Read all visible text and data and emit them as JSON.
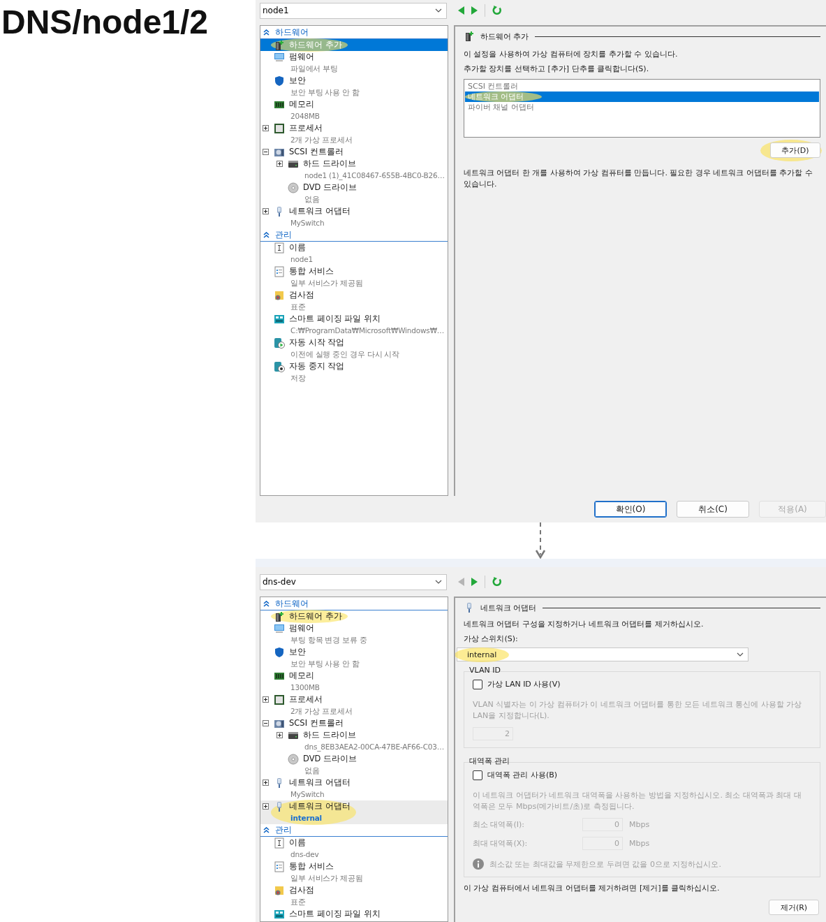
{
  "page_title": "DNS/node1/2",
  "windows": [
    {
      "vm_selector": "node1",
      "back_enabled": true,
      "tree_focused": true,
      "tree": [
        {
          "kind": "section",
          "label": "하드웨어",
          "expanded": true,
          "children": [
            {
              "kind": "add-hardware",
              "label": "하드웨어 추가",
              "selected": true,
              "highlighted": true
            },
            {
              "kind": "firmware",
              "label": "펌웨어",
              "detail": "파일에서 부팅",
              "selected": false,
              "highlighted": false
            },
            {
              "kind": "security",
              "label": "보안",
              "detail": "보안 부팅 사용 안 함",
              "selected": false,
              "highlighted": false
            },
            {
              "kind": "memory",
              "label": "메모리",
              "detail": "2048MB",
              "selected": false,
              "highlighted": false
            },
            {
              "kind": "processor",
              "label": "프로세서",
              "detail": "2개 가상 프로세서",
              "expanded": false,
              "selected": false,
              "highlighted": false
            },
            {
              "kind": "scsi",
              "label": "SCSI 컨트롤러",
              "expanded": true,
              "selected": false,
              "highlighted": false,
              "children": [
                {
                  "kind": "hard-drive",
                  "label": "하드 드라이브",
                  "detail": "node1 (1)_41C08467-655B-4BC0-B26…",
                  "expanded": false,
                  "selected": false,
                  "highlighted": false
                },
                {
                  "kind": "dvd",
                  "label": "DVD 드라이브",
                  "detail": "없음",
                  "selected": false,
                  "highlighted": false
                }
              ]
            },
            {
              "kind": "network",
              "label": "네트워크 어댑터",
              "detail": "MySwitch",
              "expanded": false,
              "selected": false,
              "highlighted": false
            }
          ]
        },
        {
          "kind": "section",
          "label": "관리",
          "expanded": true,
          "children": [
            {
              "kind": "name",
              "label": "이름",
              "detail": "node1",
              "selected": false,
              "highlighted": false
            },
            {
              "kind": "integration",
              "label": "통합 서비스",
              "detail": "일부 서비스가 제공됨",
              "selected": false,
              "highlighted": false
            },
            {
              "kind": "checkpoint",
              "label": "검사점",
              "detail": "표준",
              "selected": false,
              "highlighted": false
            },
            {
              "kind": "paging",
              "label": "스마트 페이징 파일 위치",
              "detail": "C:₩ProgramData₩Microsoft₩Windows₩…",
              "selected": false,
              "highlighted": false
            },
            {
              "kind": "autostart",
              "label": "자동 시작 작업",
              "detail": "이전에 실행 중인 경우 다시 시작",
              "selected": false,
              "highlighted": false
            },
            {
              "kind": "autostop",
              "label": "자동 중지 작업",
              "detail": "저장",
              "selected": false,
              "highlighted": false
            }
          ]
        }
      ],
      "detail": {
        "kind": "add_hardware",
        "heading": "하드웨어 추가",
        "intro": "이 설정을 사용하여 가상 컴퓨터에 장치를 추가할 수 있습니다.",
        "instruction": "추가할 장치를 선택하고 [추가] 단추를 클릭합니다(S).",
        "devices": [
          {
            "label": "SCSI 컨트롤러",
            "selected": false,
            "highlighted": false
          },
          {
            "label": "네트워크 어댑터",
            "selected": true,
            "highlighted": true
          },
          {
            "label": "파이버 채널 어댑터",
            "selected": false,
            "highlighted": false
          }
        ],
        "add_button": {
          "label": "추가(D)",
          "highlighted": true
        },
        "note": "네트워크 어댑터 한 개를 사용하여 가상 컴퓨터를 만듭니다. 필요한 경우 네트워크 어댑터를 추가할 수 있습니다."
      },
      "buttons": [
        {
          "label": "확인(O)",
          "default": true,
          "disabled": false
        },
        {
          "label": "취소(C)",
          "default": false,
          "disabled": false
        },
        {
          "label": "적용(A)",
          "default": false,
          "disabled": true
        }
      ]
    },
    {
      "vm_selector": "dns-dev",
      "back_enabled": false,
      "tree_focused": false,
      "tree": [
        {
          "kind": "section",
          "label": "하드웨어",
          "expanded": true,
          "children": [
            {
              "kind": "add-hardware",
              "label": "하드웨어 추가",
              "selected": false,
              "highlighted": true
            },
            {
              "kind": "firmware",
              "label": "펌웨어",
              "detail": "부팅 항목 변경 보류 중",
              "selected": false,
              "highlighted": false
            },
            {
              "kind": "security",
              "label": "보안",
              "detail": "보안 부팅 사용 안 함",
              "selected": false,
              "highlighted": false
            },
            {
              "kind": "memory",
              "label": "메모리",
              "detail": "1300MB",
              "selected": false,
              "highlighted": false
            },
            {
              "kind": "processor",
              "label": "프로세서",
              "detail": "2개 가상 프로세서",
              "expanded": false,
              "selected": false,
              "highlighted": false
            },
            {
              "kind": "scsi",
              "label": "SCSI 컨트롤러",
              "expanded": true,
              "selected": false,
              "highlighted": false,
              "children": [
                {
                  "kind": "hard-drive",
                  "label": "하드 드라이브",
                  "detail": "dns_8EB3AEA2-00CA-47BE-AF66-C03…",
                  "expanded": false,
                  "selected": false,
                  "highlighted": false
                },
                {
                  "kind": "dvd",
                  "label": "DVD 드라이브",
                  "detail": "없음",
                  "selected": false,
                  "highlighted": false
                }
              ]
            },
            {
              "kind": "network",
              "label": "네트워크 어댑터",
              "detail": "MySwitch",
              "expanded": false,
              "selected": false,
              "highlighted": false
            },
            {
              "kind": "network",
              "label": "네트워크 어댑터",
              "detail": "internal",
              "expanded": false,
              "selected": true,
              "highlighted": true
            }
          ]
        },
        {
          "kind": "section",
          "label": "관리",
          "expanded": true,
          "children": [
            {
              "kind": "name",
              "label": "이름",
              "detail": "dns-dev",
              "selected": false,
              "highlighted": false
            },
            {
              "kind": "integration",
              "label": "통합 서비스",
              "detail": "일부 서비스가 제공됨",
              "selected": false,
              "highlighted": false
            },
            {
              "kind": "checkpoint",
              "label": "검사점",
              "detail": "표준",
              "selected": false,
              "highlighted": false
            },
            {
              "kind": "paging",
              "label": "스마트 페이징 파일 위치",
              "selected": false,
              "highlighted": false
            }
          ]
        }
      ],
      "detail": {
        "kind": "network_adapter",
        "heading": "네트워크 어댑터",
        "intro": "네트워크 어댑터 구성을 지정하거나 네트워크 어댑터를 제거하십시오.",
        "switch_label": "가상 스위치(S):",
        "switch": {
          "value": "internal",
          "highlighted": true
        },
        "groups": [
          {
            "title": "VLAN ID",
            "checkbox": {
              "label": "가상 LAN ID 사용(V)",
              "checked": false
            },
            "description": "VLAN 식별자는 이 가상 컴퓨터가 이 네트워크 어댑터를 통한 모든 네트워크 통신에 사용할 가상 LAN을 지정합니다(L).",
            "fields": [
              {
                "value": "2"
              }
            ]
          },
          {
            "title": "대역폭 관리",
            "checkbox": {
              "label": "대역폭 관리 사용(B)",
              "checked": false
            },
            "description": "이 네트워크 어댑터가 네트워크 대역폭을 사용하는 방법을 지정하십시오. 최소 대역폭과 최대 대역폭은 모두 Mbps(메가비트/초)로 측정됩니다.",
            "fields": [
              {
                "label": "최소 대역폭(I):",
                "value": "0",
                "unit": "Mbps"
              },
              {
                "label": "최대 대역폭(X):",
                "value": "0",
                "unit": "Mbps"
              }
            ],
            "info": "최소값 또는 최대값을 무제한으로 두려면 값을 0으로 지정하십시오."
          }
        ],
        "remove_note": "이 가상 컴퓨터에서 네트워크 어댑터를 제거하려면 [제거]를 클릭하십시오.",
        "remove_button": "제거(R)"
      }
    }
  ]
}
